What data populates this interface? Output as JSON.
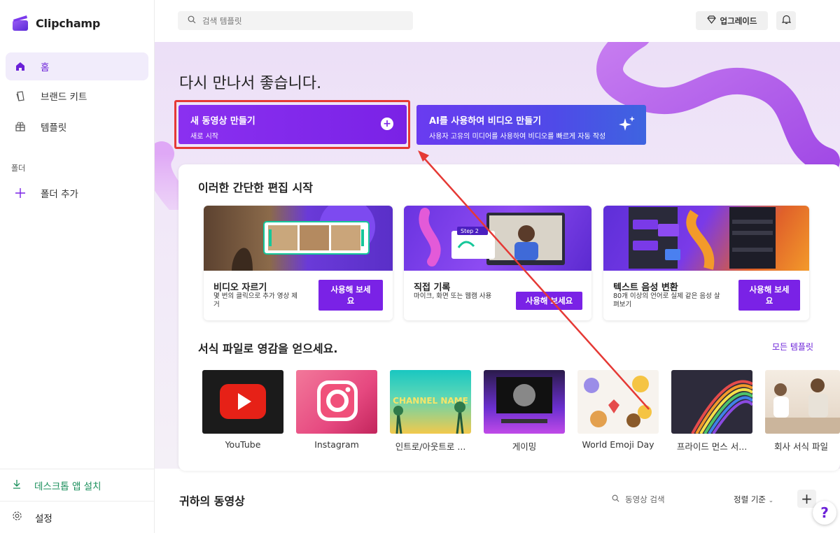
{
  "app": {
    "name": "Clipchamp"
  },
  "sidebar": {
    "items": [
      {
        "label": "홈",
        "icon": "home-icon"
      },
      {
        "label": "브랜드 키트",
        "icon": "brand-kit-icon"
      },
      {
        "label": "템플릿",
        "icon": "templates-icon"
      }
    ],
    "section_label": "폴더",
    "add_folder": "폴더 추가",
    "install_desktop": "데스크톱 앱 설치",
    "settings": "설정"
  },
  "topbar": {
    "search_placeholder": "검색 템플릿",
    "upgrade_label": "업그레이드"
  },
  "hero": {
    "title": "다시 만나서 좋습니다.",
    "create": {
      "title": "새 동영상 만들기",
      "subtitle": "새로 시작"
    },
    "ai": {
      "title": "AI를 사용하여 비디오 만들기",
      "subtitle": "사용자 고유의 미디어를 사용하여 비디오를 빠르게 자동 작성"
    }
  },
  "quick_edit": {
    "title": "이러한 간단한 편집 시작",
    "cards": [
      {
        "title": "비디오 자르기",
        "desc_line1": "몇 번의 클릭으로 추가 영상 제",
        "desc_line2": "거",
        "button_line1": "사용해 보세",
        "button_line2": "요"
      },
      {
        "title": "직접 기록",
        "desc_line1": "마이크, 화면 또는 웹캠 사용",
        "desc_line2": "",
        "button": "사용해 보세요",
        "step_label": "Step 2"
      },
      {
        "title": "텍스트 음성 변환",
        "desc_line1": "80개 이상의 언어로 실제 같은 음성 살",
        "desc_line2": "펴보기",
        "button_line1": "사용해 보세",
        "button_line2": "요"
      }
    ]
  },
  "templates": {
    "title": "서식 파일로 영감을 얻으세요.",
    "all_link": "모든 템플릿",
    "items": [
      {
        "label": "YouTube"
      },
      {
        "label": "Instagram"
      },
      {
        "label": "인트로/아웃트로 ...",
        "overlay": "CHANNEL NAME"
      },
      {
        "label": "게이밍"
      },
      {
        "label": "World Emoji Day"
      },
      {
        "label": "프라이드 먼스 서..."
      },
      {
        "label": "회사 서식 파일"
      }
    ]
  },
  "videos": {
    "title": "귀하의 동영상",
    "search_placeholder": "동영상 검색",
    "sort_label": "정렬 기준",
    "help": "?"
  },
  "colors": {
    "accent": "#7a22e6",
    "highlight": "#e53935",
    "ai_gradient_end": "#3e64e0"
  }
}
